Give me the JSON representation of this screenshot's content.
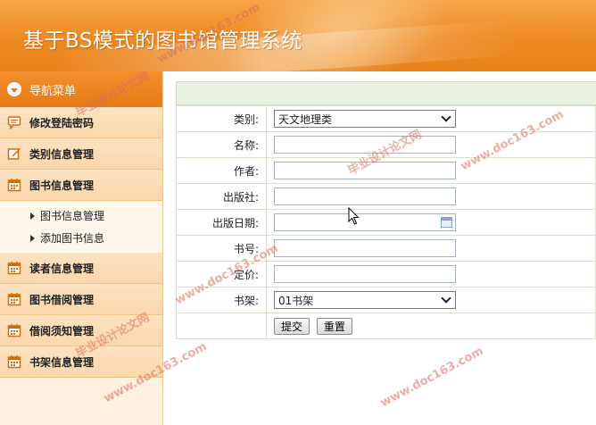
{
  "header": {
    "title": "基于BS模式的图书馆管理系统"
  },
  "sidebar": {
    "head_label": "导航菜单",
    "items": [
      {
        "label": "修改登陆密码",
        "icon": "chat-icon"
      },
      {
        "label": "类别信息管理",
        "icon": "edit-icon"
      },
      {
        "label": "图书信息管理",
        "icon": "calendar-icon"
      },
      {
        "label": "读者信息管理",
        "icon": "calendar-icon"
      },
      {
        "label": "图书借阅管理",
        "icon": "calendar-icon"
      },
      {
        "label": "借阅须知管理",
        "icon": "calendar-icon"
      },
      {
        "label": "书架信息管理",
        "icon": "calendar-icon"
      }
    ],
    "submenu": [
      {
        "label": "图书信息管理"
      },
      {
        "label": "添加图书信息"
      }
    ]
  },
  "form": {
    "category_label": "类别:",
    "category_value": "天文地理类",
    "name_label": "名称:",
    "author_label": "作者:",
    "publisher_label": "出版社:",
    "pubdate_label": "出版日期:",
    "isbn_label": "书号:",
    "price_label": "定价:",
    "shelf_label": "书架:",
    "shelf_value": "01书架",
    "submit_label": "提交",
    "reset_label": "重置"
  },
  "watermarks": {
    "site": "www.doc163.com",
    "cn": "毕业设计论文网"
  },
  "colors": {
    "accent": "#e97a14",
    "header": "#ee8a22",
    "band": "#e8f0e2"
  }
}
